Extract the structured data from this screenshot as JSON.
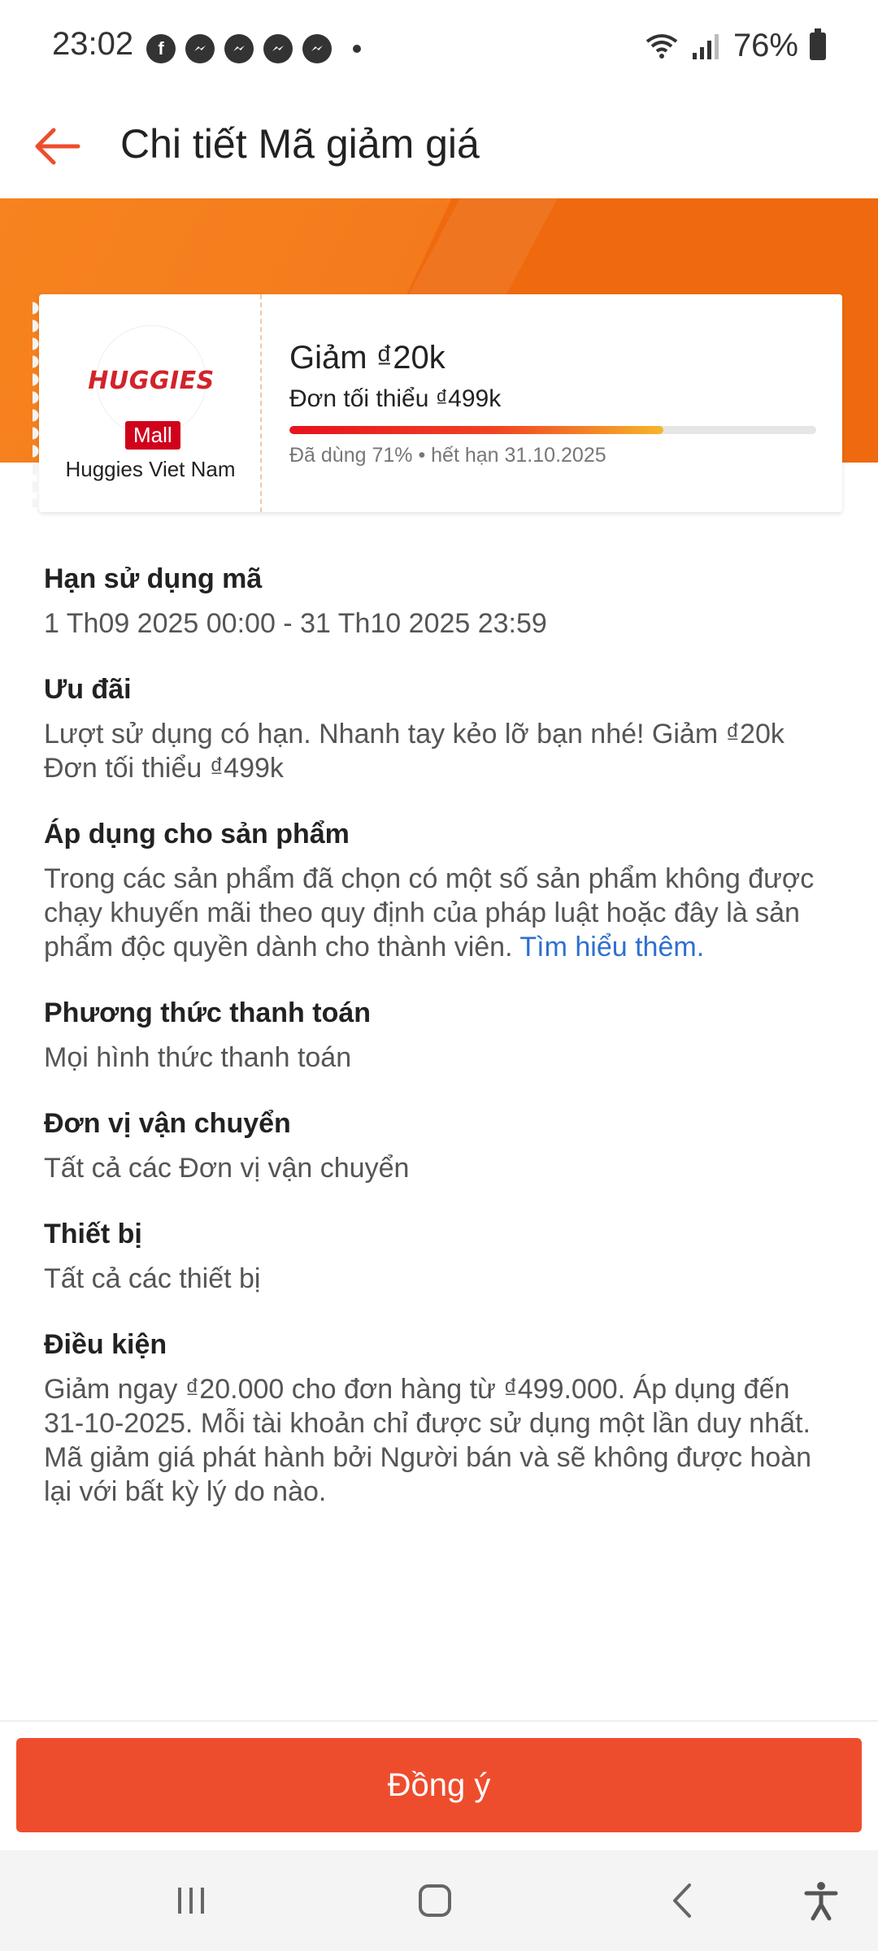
{
  "status_bar": {
    "time": "23:02",
    "notification_icons": [
      "facebook-icon",
      "messenger-icon",
      "messenger-icon",
      "messenger-icon",
      "messenger-icon"
    ],
    "battery": "76%"
  },
  "header": {
    "title": "Chi tiết Mã giảm giá",
    "back_icon": "back-arrow-icon"
  },
  "voucher": {
    "shop_logo_text": "HUGGIES",
    "mall_badge": "Mall",
    "shop_name": "Huggies Viet Nam",
    "title": "Giảm ₫20k",
    "min_order": "Đơn tối thiểu ₫499k",
    "used_percent": 71,
    "usage_text": "Đã dùng 71% • hết hạn 31.10.2025"
  },
  "sections": {
    "validity": {
      "heading": "Hạn sử dụng mã",
      "body": "1 Th09 2025 00:00 - 31 Th10 2025 23:59"
    },
    "offer": {
      "heading": "Ưu đãi",
      "body": "Lượt sử dụng có hạn. Nhanh tay kẻo lỡ bạn nhé! Giảm ₫20k Đơn tối thiểu ₫499k"
    },
    "products": {
      "heading": "Áp dụng cho sản phẩm",
      "body": "Trong các sản phẩm đã chọn có một số sản phẩm không được chạy khuyến mãi theo quy định của pháp luật hoặc đây là sản phẩm độc quyền dành cho thành viên.",
      "link": "Tìm hiểu thêm."
    },
    "payment": {
      "heading": "Phương thức thanh toán",
      "body": "Mọi hình thức thanh toán"
    },
    "shipping": {
      "heading": "Đơn vị vận chuyển",
      "body": "Tất cả các Đơn vị vận chuyển"
    },
    "device": {
      "heading": "Thiết bị",
      "body": "Tất cả các thiết bị"
    },
    "conditions": {
      "heading": "Điều kiện",
      "body": "Giảm ngay ₫20.000 cho đơn hàng từ ₫499.000. Áp dụng đến 31-10-2025. Mỗi tài khoản chỉ được sử dụng một lần duy nhất. Mã giảm giá phát hành bởi Người bán và sẽ không được hoàn lại với bất kỳ lý do nào."
    }
  },
  "footer": {
    "agree_label": "Đồng ý"
  },
  "colors": {
    "primary": "#ee4d2d",
    "banner": "#f47b1c",
    "link": "#2f6fd1"
  }
}
